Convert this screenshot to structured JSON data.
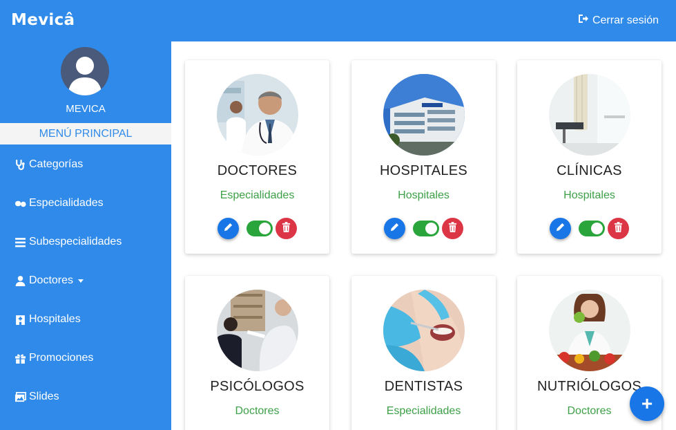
{
  "header": {
    "logo_text": "Mevicâ",
    "logout_label": "Cerrar sesión",
    "logout_icon": "sign-out-icon",
    "bg_color": "#2f8ae9"
  },
  "sidebar": {
    "user_name": "MEVICA",
    "menu_title": "MENÚ PRINCIPAL",
    "items": [
      {
        "label": "Categorías",
        "icon": "stethoscope-icon"
      },
      {
        "label": "Especialidades",
        "icon": "pills-icon"
      },
      {
        "label": "Subespecialidades",
        "icon": "list-icon"
      },
      {
        "label": "Doctores",
        "icon": "user-doctor-icon"
      },
      {
        "label": "Hospitales",
        "icon": "hospital-icon"
      },
      {
        "label": "Promociones",
        "icon": "gift-icon"
      },
      {
        "label": "Slides",
        "icon": "images-icon"
      }
    ]
  },
  "cards": [
    {
      "title": "DOCTORES",
      "subtitle": "Especialidades",
      "image": "doctor-photo",
      "active": true
    },
    {
      "title": "HOSPITALES",
      "subtitle": "Hospitales",
      "image": "hospital-building-photo",
      "active": true
    },
    {
      "title": "CLÍNICAS",
      "subtitle": "Hospitales",
      "image": "clinic-room-photo",
      "active": true
    },
    {
      "title": "PSICÓLOGOS",
      "subtitle": "Doctores",
      "image": "psychologist-session-photo"
    },
    {
      "title": "DENTISTAS",
      "subtitle": "Especialidades",
      "image": "dentist-photo"
    },
    {
      "title": "NUTRIÓLOGOS",
      "subtitle": "Doctores",
      "image": "nutritionist-photo"
    }
  ],
  "colors": {
    "primary": "#2f8ae9",
    "edit_button": "#1976e6",
    "toggle_on": "#2aa53b",
    "delete_button": "#dc3545",
    "subtitle_text": "#3da047"
  },
  "fab": {
    "label": "+",
    "icon": "plus-icon"
  }
}
